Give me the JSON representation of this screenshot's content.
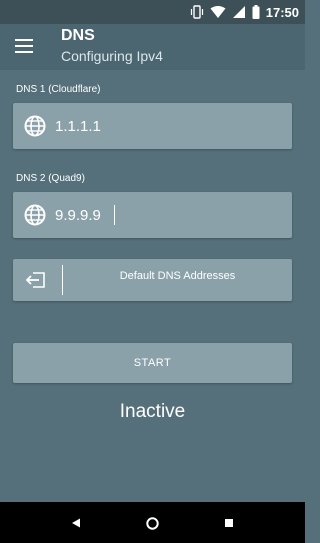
{
  "status_bar": {
    "time": "17:50",
    "icons": [
      "vibrate-icon",
      "wifi-icon",
      "signal-icon",
      "battery-icon"
    ]
  },
  "app_bar": {
    "title": "DNS",
    "subtitle": "Configuring Ipv4",
    "menu_icon": "menu-icon"
  },
  "dns1": {
    "label": "DNS 1 (Cloudflare)",
    "value": "1.1.1.1",
    "icon": "globe-icon"
  },
  "dns2": {
    "label": "DNS 2 (Quad9)",
    "value": "9.9.9.9",
    "icon": "globe-icon"
  },
  "default_button": {
    "label": "Default DNS Addresses",
    "icon": "import-icon"
  },
  "start_button": {
    "label": "START"
  },
  "status": {
    "text": "Inactive"
  },
  "colors": {
    "background": "#55707a",
    "app_bar": "#4b6670",
    "status_bar": "#3d5058",
    "field": "#8ba1a9",
    "nav_bar": "#000000"
  },
  "nav_bar": {
    "icons": [
      "back-icon",
      "home-icon",
      "recents-icon"
    ]
  }
}
